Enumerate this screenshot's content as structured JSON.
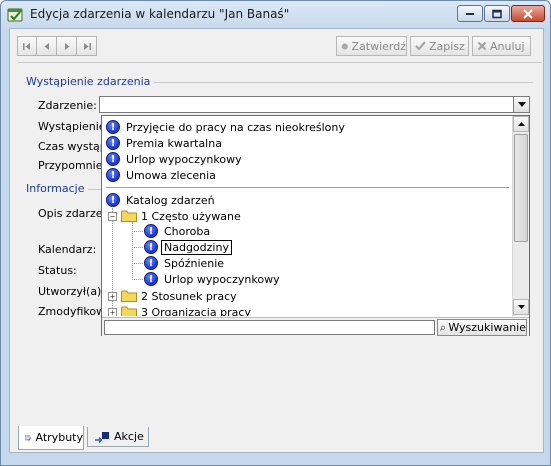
{
  "window": {
    "title": "Edycja zdarzenia w kalendarzu \"Jan Banaś\""
  },
  "toolbar": {
    "confirm_label": "Zatwierdź",
    "save_label": "Zapisz",
    "cancel_label": "Anuluj"
  },
  "section_occurrence": {
    "header": "Wystąpienie zdarzenia",
    "labels": {
      "event": "Zdarzenie:",
      "occurrence": "Wystąpienie",
      "time": "Czas wystąp",
      "reminder": "Przypomnien"
    },
    "event_value": ""
  },
  "section_info": {
    "header": "Informacje",
    "labels": {
      "description": "Opis zdarzen",
      "calendar": "Kalendarz:",
      "status": "Status:",
      "created_by": "Utworzył(a):",
      "modified_by": "Zmodyfikowa"
    }
  },
  "dropdown": {
    "recent_items": [
      "Przyjęcie do pracy na czas nieokreślony",
      "Premia kwartalna",
      "Urlop wypoczynkowy",
      "Umowa zlecenia"
    ],
    "catalog_label": "Katalog zdarzeń",
    "folders": [
      {
        "label": "1 Często używane",
        "expanded": true,
        "children": [
          "Choroba",
          "Nadgodziny",
          "Spóźnienie",
          "Urlop wypoczynkowy"
        ]
      },
      {
        "label": "2 Stosunek pracy",
        "expanded": false
      },
      {
        "label": "3 Organizacja pracy",
        "expanded": false
      }
    ],
    "selected_item": "Nadgodziny",
    "search_placeholder": "",
    "search_button_label": "Wyszukiwanie"
  },
  "tabs": [
    {
      "label": "Atrybuty",
      "active": true,
      "icon": "attributes-icon"
    },
    {
      "label": "Akcje",
      "active": false,
      "icon": "actions-icon"
    }
  ],
  "colors": {
    "group_header": "#1f3a93",
    "info_icon": "#1a35c9",
    "folder": "#f5d85a"
  }
}
